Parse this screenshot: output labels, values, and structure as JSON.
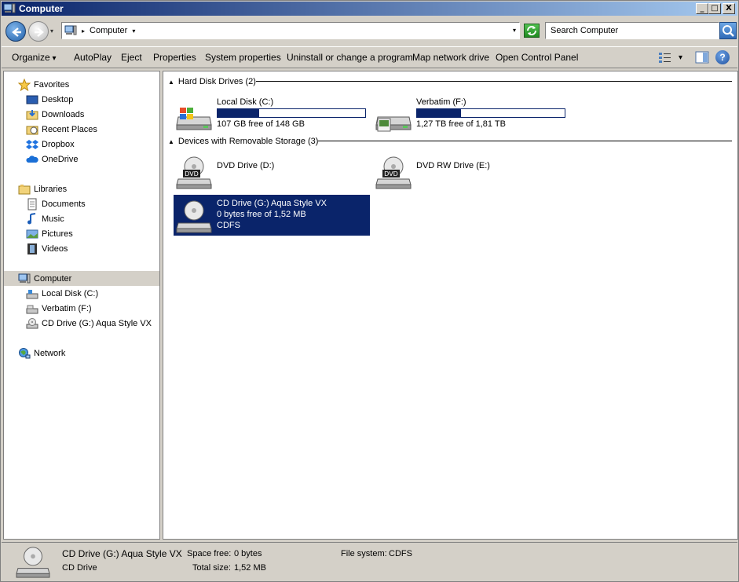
{
  "window": {
    "title": "Computer",
    "controls": {
      "minimize": "_",
      "maximize": "□",
      "close": "X"
    }
  },
  "address": {
    "crumb": "Computer",
    "search_placeholder": "Search Computer"
  },
  "toolbar": {
    "organize": "Organize",
    "autoplay": "AutoPlay",
    "eject": "Eject",
    "properties": "Properties",
    "system_properties": "System properties",
    "uninstall": "Uninstall or change a program",
    "map_network": "Map network drive",
    "control_panel": "Open Control Panel"
  },
  "nav": {
    "favorites": "Favorites",
    "desktop": "Desktop",
    "downloads": "Downloads",
    "recent": "Recent Places",
    "dropbox": "Dropbox",
    "onedrive": "OneDrive",
    "libraries": "Libraries",
    "documents": "Documents",
    "music": "Music",
    "pictures": "Pictures",
    "videos": "Videos",
    "computer": "Computer",
    "local_disk": "Local Disk (C:)",
    "verbatim": "Verbatim (F:)",
    "cd_drive": "CD Drive (G:) Aqua Style VX",
    "network": "Network"
  },
  "groups": {
    "hdd": "Hard Disk Drives (2)",
    "removable": "Devices with Removable Storage (3)"
  },
  "drives": {
    "c": {
      "name": "Local Disk (C:)",
      "info": "107 GB free of 148 GB",
      "used_fraction": 0.28
    },
    "f": {
      "name": "Verbatim (F:)",
      "info": "1,27 TB free of 1,81 TB",
      "used_fraction": 0.3
    },
    "d": {
      "name": "DVD Drive (D:)"
    },
    "e": {
      "name": "DVD RW Drive (E:)"
    },
    "g": {
      "name": "CD Drive (G:) Aqua Style VX",
      "info": "0 bytes free of 1,52 MB",
      "fs": "CDFS"
    }
  },
  "icon_labels": {
    "dvd": "DVD"
  },
  "details": {
    "name": "CD Drive (G:) Aqua Style VX",
    "type": "CD Drive",
    "space_free_label": "Space free:",
    "space_free": "0 bytes",
    "total_size_label": "Total size:",
    "total_size": "1,52 MB",
    "file_system_label": "File system:",
    "file_system": "CDFS"
  },
  "colors": {
    "selection": "#0a246a",
    "chrome": "#d4d0c8"
  }
}
